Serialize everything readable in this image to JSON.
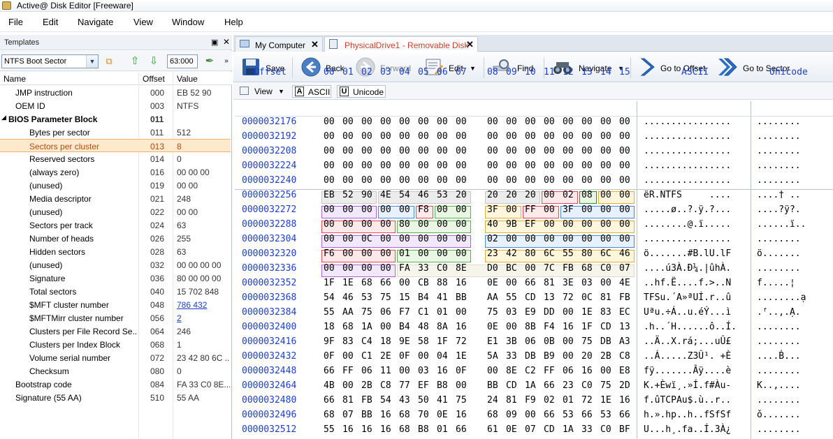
{
  "window": {
    "title": "Active@ Disk Editor [Freeware]"
  },
  "menu": [
    "File",
    "Edit",
    "Navigate",
    "View",
    "Window",
    "Help"
  ],
  "templates_panel": {
    "title": "Templates",
    "template_name": "NTFS Boot Sector",
    "offset_value": "63:000",
    "columns": [
      "Name",
      "Offset",
      "Value"
    ],
    "rows": [
      {
        "name": "JMP instruction",
        "offset": "000",
        "value": "EB 52 90",
        "level": 1
      },
      {
        "name": "OEM ID",
        "offset": "003",
        "value": "NTFS",
        "level": 1
      },
      {
        "name": "BIOS Parameter Block",
        "offset": "011",
        "value": "",
        "level": 0,
        "bold": true
      },
      {
        "name": "Bytes per sector",
        "offset": "011",
        "value": "512",
        "level": 2
      },
      {
        "name": "Sectors per cluster",
        "offset": "013",
        "value": "8",
        "level": 2,
        "selected": true
      },
      {
        "name": "Reserved sectors",
        "offset": "014",
        "value": "0",
        "level": 2
      },
      {
        "name": "(always zero)",
        "offset": "016",
        "value": "00 00 00",
        "level": 2
      },
      {
        "name": "(unused)",
        "offset": "019",
        "value": "00 00",
        "level": 2
      },
      {
        "name": "Media descriptor",
        "offset": "021",
        "value": "248",
        "level": 2
      },
      {
        "name": "(unused)",
        "offset": "022",
        "value": "00 00",
        "level": 2
      },
      {
        "name": "Sectors per track",
        "offset": "024",
        "value": "63",
        "level": 2
      },
      {
        "name": "Number of heads",
        "offset": "026",
        "value": "255",
        "level": 2
      },
      {
        "name": "Hidden sectors",
        "offset": "028",
        "value": "63",
        "level": 2
      },
      {
        "name": "(unused)",
        "offset": "032",
        "value": "00 00 00 00",
        "level": 2
      },
      {
        "name": "Signature",
        "offset": "036",
        "value": "80 00 00 00",
        "level": 2
      },
      {
        "name": "Total sectors",
        "offset": "040",
        "value": "15 702 848",
        "level": 2
      },
      {
        "name": "$MFT cluster number",
        "offset": "048",
        "value": "786 432",
        "level": 2,
        "link": true
      },
      {
        "name": "$MFTMirr cluster number",
        "offset": "056",
        "value": "2",
        "level": 2,
        "link": true
      },
      {
        "name": "Clusters per File Record Se...",
        "offset": "064",
        "value": "246",
        "level": 2
      },
      {
        "name": "Clusters per Index Block",
        "offset": "068",
        "value": "1",
        "level": 2
      },
      {
        "name": "Volume serial number",
        "offset": "072",
        "value": "23 42 80 6C ...",
        "level": 2
      },
      {
        "name": "Checksum",
        "offset": "080",
        "value": "0",
        "level": 2
      },
      {
        "name": "Bootstrap code",
        "offset": "084",
        "value": "FA 33 C0 8E...",
        "level": 1
      },
      {
        "name": "Signature (55 AA)",
        "offset": "510",
        "value": "55 AA",
        "level": 1
      }
    ]
  },
  "tabs": [
    {
      "label": "My Computer",
      "active": false
    },
    {
      "label": "PhysicalDrive1 - Removable Disk",
      "active": true
    }
  ],
  "toolbar": {
    "save": "Save",
    "back": "Back",
    "forward": "Forward",
    "edit": "Edit",
    "find": "Find",
    "navigate": "Navigate",
    "goto_offset": "Go to Offset",
    "goto_sector": "Go to Sector"
  },
  "subbar": {
    "view": "View",
    "ascii": "ASCII",
    "unicode": "Unicode"
  },
  "hex_view": {
    "offset_header": "Offset",
    "byte_headers": [
      "00",
      "01",
      "02",
      "03",
      "04",
      "05",
      "06",
      "07",
      "08",
      "09",
      "10",
      "11",
      "12",
      "13",
      "14",
      "15"
    ],
    "ascii_header": "ASCII",
    "unicode_header": "Unicode",
    "rows": [
      {
        "offset": "0000032176",
        "bytes": "00 00 00 00 00 00 00 00 00 00 00 00 00 00 00 00",
        "ascii": "................",
        "unicode": "........"
      },
      {
        "offset": "0000032192",
        "bytes": "00 00 00 00 00 00 00 00 00 00 00 00 00 00 00 00",
        "ascii": "................",
        "unicode": "........"
      },
      {
        "offset": "0000032208",
        "bytes": "00 00 00 00 00 00 00 00 00 00 00 00 00 00 00 00",
        "ascii": "................",
        "unicode": "........"
      },
      {
        "offset": "0000032224",
        "bytes": "00 00 00 00 00 00 00 00 00 00 00 00 00 00 00 00",
        "ascii": "................",
        "unicode": "........"
      },
      {
        "offset": "0000032240",
        "bytes": "00 00 00 00 00 00 00 00 00 00 00 00 00 00 00 00",
        "ascii": "................",
        "unicode": "........"
      },
      {
        "offset": "0000032256",
        "bytes": "EB 52 90 4E 54 46 53 20 20 20 20 00 02 08 00 00",
        "ascii": "ëR.NTFS     ....",
        "unicode": "....† .."
      },
      {
        "offset": "0000032272",
        "bytes": "00 00 00 00 00 F8 00 00 3F 00 FF 00 3F 00 00 00",
        "ascii": ".....ø..?.ÿ.?...",
        "unicode": "....?ÿ?."
      },
      {
        "offset": "0000032288",
        "bytes": "00 00 00 00 80 00 00 00 40 9B EF 00 00 00 00 00",
        "ascii": "........@.ï.....",
        "unicode": "......ï.."
      },
      {
        "offset": "0000032304",
        "bytes": "00 00 0C 00 00 00 00 00 02 00 00 00 00 00 00 00",
        "ascii": "................",
        "unicode": "........"
      },
      {
        "offset": "0000032320",
        "bytes": "F6 00 00 00 01 00 00 00 23 42 80 6C 55 80 6C 46",
        "ascii": "ö.......#B.lU.lF",
        "unicode": "ö......."
      },
      {
        "offset": "0000032336",
        "bytes": "00 00 00 00 FA 33 C0 8E D0 BC 00 7C FB 68 C0 07",
        "ascii": "....ú3À.Ð¼.|ûhÀ.",
        "unicode": "........"
      },
      {
        "offset": "0000032352",
        "bytes": "1F 1E 68 66 00 CB 88 16 0E 00 66 81 3E 03 00 4E",
        "ascii": "..hf.Ë....f.>..N",
        "unicode": "f.....¦"
      },
      {
        "offset": "0000032368",
        "bytes": "54 46 53 75 15 B4 41 BB AA 55 CD 13 72 0C 81 FB",
        "ascii": "TFSu.´A»ªUÍ.r..û",
        "unicode": "........ạ"
      },
      {
        "offset": "0000032384",
        "bytes": "55 AA 75 06 F7 C1 01 00 75 03 E9 DD 00 1E 83 EC",
        "ascii": "Uªu.÷Á..u.éÝ...ì",
        "unicode": ".ᶠ..,.Ạ."
      },
      {
        "offset": "0000032400",
        "bytes": "18 68 1A 00 B4 48 8A 16 0E 00 8B F4 16 1F CD 13",
        "ascii": ".h..´H......ô..Í.",
        "unicode": "........"
      },
      {
        "offset": "0000032416",
        "bytes": "9F 83 C4 18 9E 58 1F 72 E1 3B 06 0B 00 75 DB A3",
        "ascii": "..Ä..X.rá;...uÛ£",
        "unicode": "........"
      },
      {
        "offset": "0000032432",
        "bytes": "0F 00 C1 2E 0F 00 04 1E 5A 33 DB B9 00 20 2B C8",
        "ascii": "..Á.....Z3Û¹. +È",
        "unicode": "....Ḃ..."
      },
      {
        "offset": "0000032448",
        "bytes": "66 FF 06 11 00 03 16 0F 00 8E C2 FF 06 16 00 E8",
        "ascii": "fÿ.......Âÿ....è",
        "unicode": "........"
      },
      {
        "offset": "0000032464",
        "bytes": "4B 00 2B C8 77 EF B8 00 BB CD 1A 66 23 C0 75 2D",
        "ascii": "K.+Èwï¸.»Í.f#Àu-",
        "unicode": "K..,...."
      },
      {
        "offset": "0000032480",
        "bytes": "66 81 FB 54 43 50 41 75 24 81 F9 02 01 72 1E 16",
        "ascii": "f.ûTCPAu$.ù..r..",
        "unicode": "........"
      },
      {
        "offset": "0000032496",
        "bytes": "68 07 BB 16 68 70 0E 16 68 09 00 66 53 66 53 66",
        "ascii": "h.».hp..h..fSfSf",
        "unicode": "ǒ......."
      },
      {
        "offset": "0000032512",
        "bytes": "55 16 16 16 68 B8 01 66 61 0E 07 CD 1A 33 C0 BF",
        "ascii": "U...h¸.fa..Í.3À¿",
        "unicode": "........"
      }
    ]
  },
  "colors": {
    "offset_blue": "#1b3fcc",
    "selected_row_bg": "#fde9cc",
    "active_tab_text": "#d03a28"
  }
}
